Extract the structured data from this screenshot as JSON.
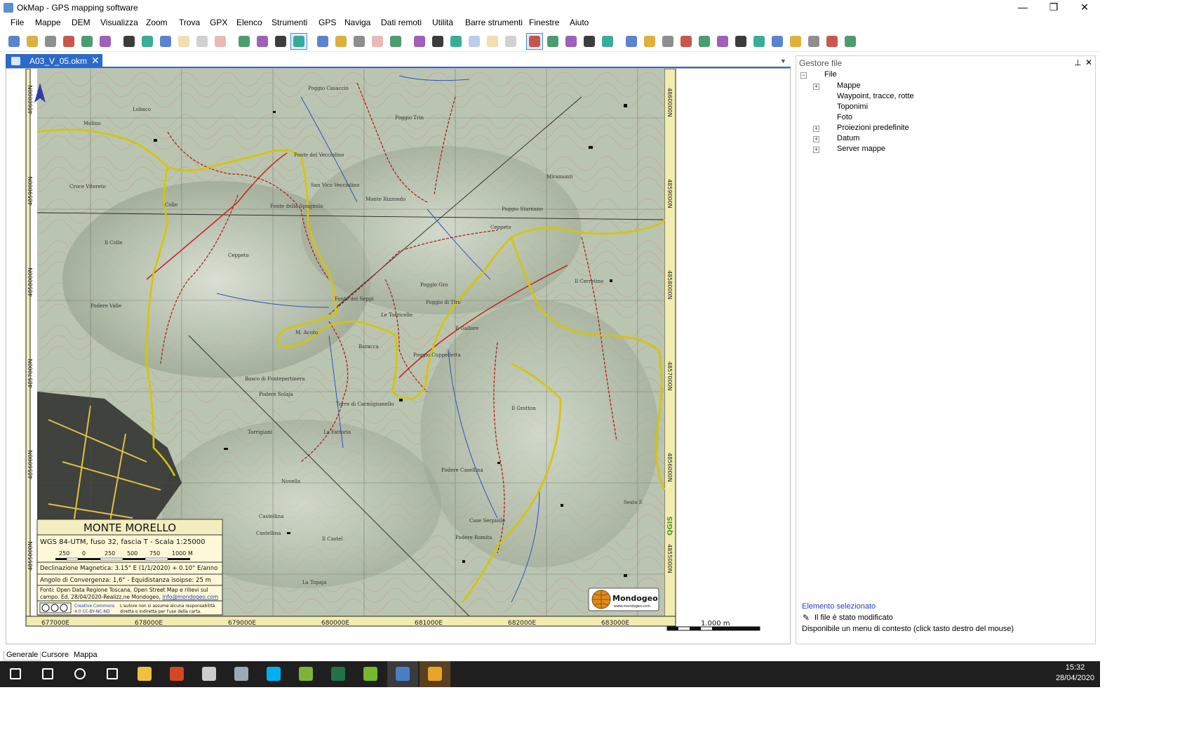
{
  "window": {
    "title": "OkMap - GPS mapping software",
    "minimize": "—",
    "maximize": "❐",
    "close": "✕"
  },
  "menu": [
    "File",
    "Mappe",
    "DEM",
    "Visualizza",
    "Zoom",
    "Trova",
    "GPX",
    "Elenco",
    "Strumenti",
    "GPS",
    "Naviga",
    "Dati remoti",
    "Utilità",
    "Barre strumenti",
    "Finestre",
    "Aiuto"
  ],
  "toolbar_icons": [
    "open-map-icon",
    "open-file-icon",
    "open-gpx-icon",
    "open-waypoints-icon",
    "open-tracks-icon",
    "open-routes-icon",
    "save-map-icon",
    "save-file-icon",
    "save-gpx-icon",
    "save-as-icon",
    "save-all-icon",
    "close-file-icon",
    "map-properties-icon",
    "map-list-icon",
    "find-icon",
    "lock-icon",
    "zoom-in-icon",
    "zoom-out-icon",
    "zoom-fit-icon",
    "zoom-previous-icon",
    "zoom-scale-icon",
    "edit-icon",
    "waypoint-add-icon",
    "table-icon",
    "copy-icon",
    "delete-icon",
    "filter-icon",
    "select-icon",
    "select-add-icon",
    "select-area-icon",
    "eraser-icon",
    "pan-icon",
    "smiley-waypoint-icon",
    "label-icon",
    "route-icon",
    "track-icon",
    "draw-icon",
    "measure-icon",
    "measure-area-icon",
    "diamond-icon",
    "pin-icon",
    "magic-icon",
    "ruler-icon",
    "ruler-area-icon",
    "ruler-cross-icon"
  ],
  "colors": {
    "accent": "#2a6ac8",
    "taskbar": "#1f1f1f",
    "selected_element": "#2a3bd0",
    "map_track": "#e6d200",
    "map_road": "#c62828"
  },
  "document_tab": {
    "label": "A03_V_05.okm",
    "close": "✕"
  },
  "map": {
    "title": "MONTE MORELLO",
    "projection": "WGS 84-UTM, fuso 32, fascia T - Scala 1:25000",
    "scale_labels": [
      "250",
      "0",
      "250",
      "500",
      "750",
      "1000 M"
    ],
    "declination": "Declinazione Magnetica: 3.15° E (1/1/2020) + 0.10° E/anno",
    "convergence": "Angolo di Convergenza: 1,6° - Equidistanza isoipse: 25 m",
    "sources_1": "Fonti: Open Data Regione Toscana, Open Street Map e rilievi sul",
    "sources_2": "campo. Ed. 28/04/2020-Realizz.ne Mondogeo,",
    "email": "info@mondogeo.com",
    "license_1": "Creative Commons",
    "license_2": "4.0 CC-BY-NC-ND",
    "disclaimer_1": "L'autore non si assume alcuna responsabilità",
    "disclaimer_2": "diretta o indiretta per l'uso della carta.",
    "brand": "Mondogeo",
    "brand_url": "www.mondogeo.com",
    "made_with": "QGIS",
    "map_scale_bar": "1.000 m",
    "x_ticks": [
      "677000E",
      "678000E",
      "679000E",
      "680000E",
      "681000E",
      "682000E",
      "683000E"
    ],
    "y_ticks": [
      "4860000N",
      "4859000N",
      "4858000N",
      "4857000N",
      "4856000N",
      "4855000N"
    ],
    "place_names": [
      "Poggio Casaccio",
      "Poggio Trin",
      "Fonte del Vecciolino",
      "San Vico Vecciolino",
      "Monte Rizzondo",
      "Fonte della Spugnola",
      "Croce Vitereto",
      "Colle",
      "Il Colle",
      "Poggio Starnano",
      "Ceppeto",
      "Miramonti",
      "Podere Valle",
      "Ceppeto",
      "Il Cerretino",
      "Poggio Gro",
      "Poggio di Tiro",
      "Il Gallore",
      "M. Acuto",
      "Le Torricelle",
      "Baracca",
      "Poggio Cuppelletta",
      "Fonte dei Seppi",
      "Lubaco",
      "Molino",
      "Bosco di Fontepertinera",
      "Podere Solaja",
      "Torre di Carmignanello",
      "La Fattoria",
      "Torrigiani",
      "Novella",
      "Castellina",
      "Il Castel",
      "La Topaja",
      "Case Serpiolle",
      "Podere Romita",
      "Podere Casellina",
      "Il Grotton",
      "Sesto F.",
      "Castellina"
    ]
  },
  "file_manager": {
    "title": "Gestore file",
    "pin": "📌",
    "close": "✕",
    "root": "File",
    "items": [
      {
        "label": "Mappe",
        "expandable": true
      },
      {
        "label": "Waypoint, tracce, rotte",
        "expandable": false
      },
      {
        "label": "Toponimi",
        "expandable": false
      },
      {
        "label": "Foto",
        "expandable": false
      },
      {
        "label": "Proiezioni predefinite",
        "expandable": true
      },
      {
        "label": "Datum",
        "expandable": true
      },
      {
        "label": "Server mappe",
        "expandable": true
      }
    ],
    "selected_title": "Elemento selezionato",
    "selected_status": "Il file è stato modificato",
    "selected_hint": "Disponibile un menu di contesto (click tasto destro del mouse)"
  },
  "bottom_tabs": [
    "Generale",
    "Cursore",
    "Mappa"
  ],
  "taskbar": {
    "apps": [
      "windows-start-icon",
      "search-icon",
      "cortana-icon",
      "task-view-icon",
      "file-explorer-icon",
      "powerpoint-icon",
      "calculator-icon",
      "steam-icon",
      "skype-icon",
      "notepad-icon",
      "excel-icon",
      "qgis-icon",
      "okmap-icon",
      "chrome-icon"
    ],
    "time": "15:32",
    "date": "28/04/2020"
  }
}
